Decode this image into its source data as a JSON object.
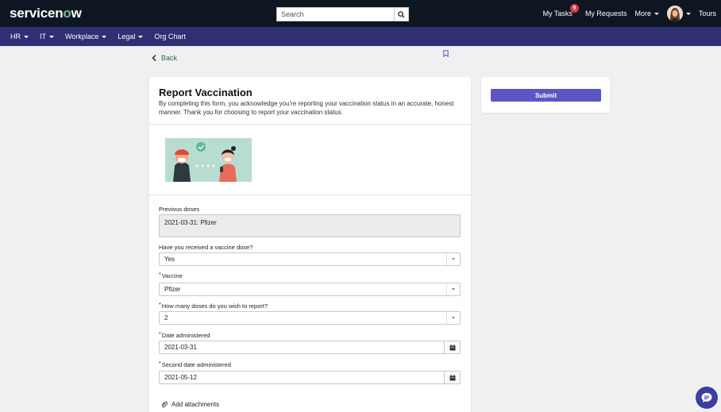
{
  "header": {
    "logo_prefix": "servicen",
    "logo_o": "o",
    "logo_suffix": "w",
    "search_placeholder": "Search",
    "my_tasks": "My Tasks",
    "my_tasks_badge": "9",
    "my_requests": "My Requests",
    "more": "More",
    "tours": "Tours"
  },
  "subnav": {
    "items": [
      {
        "label": "HR",
        "dropdown": true
      },
      {
        "label": "IT",
        "dropdown": true
      },
      {
        "label": "Workplace",
        "dropdown": true
      },
      {
        "label": "Legal",
        "dropdown": true
      },
      {
        "label": "Org Chart",
        "dropdown": false
      }
    ]
  },
  "back_label": "Back",
  "form": {
    "title": "Report Vaccination",
    "description": "By completing this form, you acknowledge you're reporting your vaccination status in an accurate, honest manner. Thank you for choosing to report your vaccination status.",
    "previous_doses_label": "Previous doses",
    "previous_doses_value": "2021-03-31: Pfizer",
    "received_label": "Have you received a vaccine dose?",
    "received_value": "Yes",
    "vaccine_label": "Vaccine",
    "vaccine_value": "Pfizer",
    "doses_label": "How many doses do you wish to report?",
    "doses_value": "2",
    "date_label": "Date administered",
    "date_value": "2021-03-31",
    "second_date_label": "Second date administered",
    "second_date_value": "2021-05-12",
    "required_marker": "*",
    "add_attachments": "Add attachments"
  },
  "submit_label": "Submit",
  "colors": {
    "topbar": "#0e1621",
    "subnav": "#2f2f74",
    "submit": "#5b56c4",
    "back_link": "#2a6a47"
  }
}
